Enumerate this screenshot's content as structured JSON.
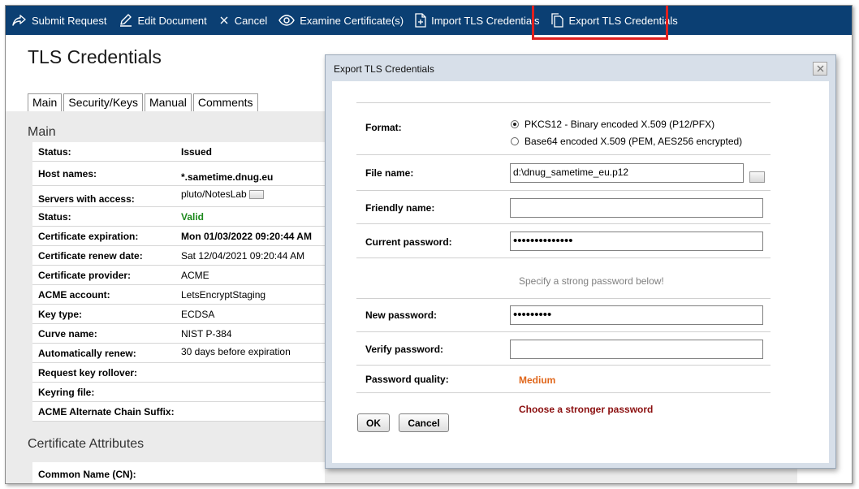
{
  "toolbar": {
    "submit": "Submit Request",
    "edit": "Edit Document",
    "cancel": "Cancel",
    "examine": "Examine Certificate(s)",
    "import": "Import TLS Credentials",
    "export": "Export TLS Credentials"
  },
  "page": {
    "title": "TLS Credentials",
    "tabs": [
      "Main",
      "Security/Keys",
      "Manual",
      "Comments"
    ]
  },
  "main": {
    "section_title": "Main",
    "rows": [
      {
        "label": "Status:",
        "value": "Issued"
      },
      {
        "label": "Host names:",
        "value": "*.sametime.dnug.eu"
      },
      {
        "label": "Servers with access:",
        "value": "pluto/NotesLab"
      },
      {
        "label": "Status:",
        "value": "Valid"
      },
      {
        "label": "Certificate expiration:",
        "value": "Mon 01/03/2022 09:20:44 AM"
      },
      {
        "label": "Certificate renew date:",
        "value": "Sat 12/04/2021 09:20:44 AM"
      },
      {
        "label": "Certificate provider:",
        "value": "ACME"
      },
      {
        "label": "ACME account:",
        "value": "LetsEncryptStaging"
      },
      {
        "label": "Key type:",
        "value": "ECDSA"
      },
      {
        "label": "Curve name:",
        "value": "NIST P-384"
      },
      {
        "label": "Automatically renew:",
        "value": "30 days before expiration"
      },
      {
        "label": "Request key rollover:",
        "value": ""
      },
      {
        "label": "Keyring file:",
        "value": ""
      },
      {
        "label": "ACME Alternate Chain Suffix:",
        "value": ""
      }
    ],
    "cert_section_title": "Certificate Attributes",
    "cert_rows": [
      {
        "label": "Common Name (CN):",
        "value": ""
      }
    ]
  },
  "dialog": {
    "title": "Export TLS Credentials",
    "format_label": "Format:",
    "format_option_1": "PKCS12 - Binary encoded X.509 (P12/PFX)",
    "format_option_2": "Base64 encoded X.509 (PEM, AES256 encrypted)",
    "file_name_label": "File name:",
    "file_name_value": "d:\\dnug_sametime_eu.p12",
    "friendly_name_label": "Friendly name:",
    "friendly_name_value": "",
    "current_password_label": "Current password:",
    "current_password_value": "••••••••••••••",
    "hint": "Specify a strong password below!",
    "new_password_label": "New password:",
    "new_password_value": "•••••••••",
    "verify_password_label": "Verify password:",
    "verify_password_value": "",
    "quality_label": "Password quality:",
    "quality_value": "Medium",
    "stronger_msg": "Choose a stronger password",
    "ok": "OK",
    "cancel": "Cancel"
  },
  "colors": {
    "toolbar_bg": "#0b3f73",
    "highlight": "#e0201e",
    "valid": "#1e8a1e",
    "quality_medium": "#e0661a",
    "warning": "#8b0f0f"
  }
}
